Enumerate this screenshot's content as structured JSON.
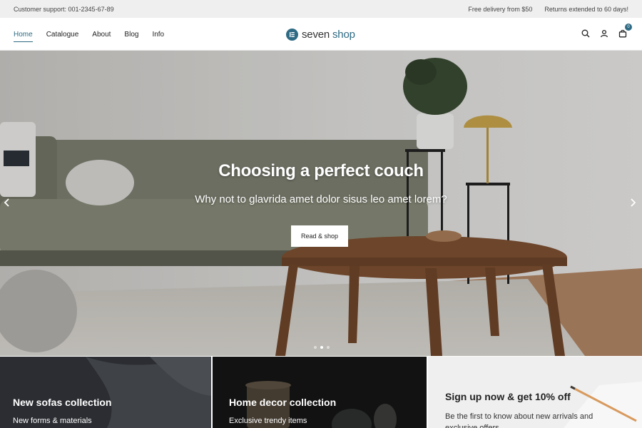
{
  "topbar": {
    "support": "Customer support: 001-2345-67-89",
    "delivery": "Free delivery from $50",
    "returns": "Returns extended to 60 days!"
  },
  "nav": {
    "items": [
      {
        "label": "Home"
      },
      {
        "label": "Catalogue"
      },
      {
        "label": "About"
      },
      {
        "label": "Blog"
      },
      {
        "label": "Info"
      }
    ]
  },
  "logo": {
    "word1": "seven",
    "word2": "shop"
  },
  "cart": {
    "count": "0"
  },
  "hero": {
    "title": "Choosing a perfect couch",
    "subtitle": "Why not to glavrida amet dolor sisus leo amet lorem?",
    "button": "Read & shop"
  },
  "promos": [
    {
      "title": "New sofas collection",
      "subtitle": "New forms & materials"
    },
    {
      "title": "Home decor collection",
      "subtitle": "Exclusive trendy items"
    },
    {
      "title": "Sign up now & get 10% off",
      "text": "Be the first to know about new arrivals and exclusive offers"
    }
  ],
  "colors": {
    "accent": "#2f6b84",
    "topbar_bg": "#efefef"
  }
}
